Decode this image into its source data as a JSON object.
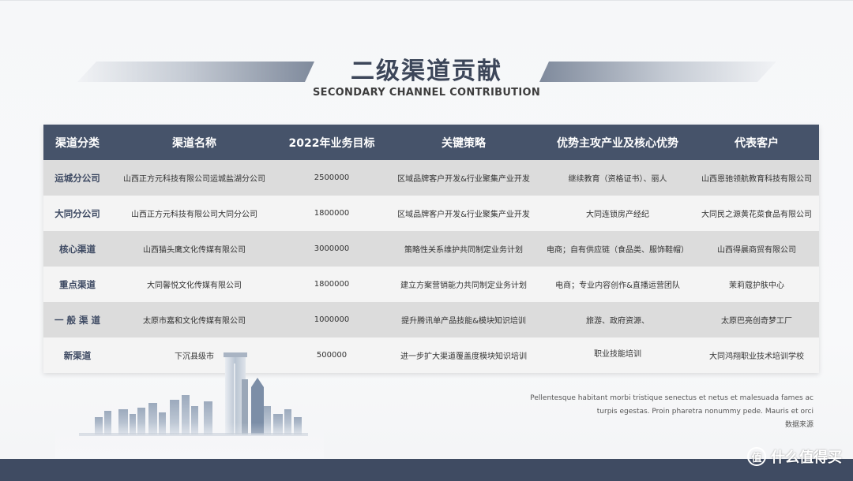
{
  "header": {
    "title": "二级渠道贡献",
    "subtitle": "SECONDARY CHANNEL CONTRIBUTION"
  },
  "table": {
    "columns": [
      "渠道分类",
      "渠道名称",
      "2022年业务目标",
      "关键策略",
      "优势主攻产业及核心优势",
      "代表客户"
    ],
    "rows": [
      {
        "category": "运城分公司",
        "name": "山西正方元科技有限公司运城盐湖分公司",
        "target": "2500000",
        "strategy": "区域品牌客户开发&行业聚集产业开发",
        "advantage": "继续教育（资格证书）、丽人",
        "client": "山西恩驰领航教育科技有限公司"
      },
      {
        "category": "大同分公司",
        "name": "山西正方元科技有限公司大同分公司",
        "target": "1800000",
        "strategy": "区域品牌客户开发&行业聚集产业开发",
        "advantage": "大同连锁房产经纪",
        "client": "大同民之源黄花菜食品有限公司"
      },
      {
        "category": "核心渠道",
        "name": "山西猫头鹰文化传媒有限公司",
        "target": "3000000",
        "strategy": "策略性关系维护共同制定业务计划",
        "advantage": "电商；自有供应链（食品类、服饰鞋帽）",
        "client": "山西得晨商贸有限公司"
      },
      {
        "category": "重点渠道",
        "name": "大同馨悦文化传媒有限公司",
        "target": "1800000",
        "strategy": "建立方案营销能力共同制定业务计划",
        "advantage": "电商；专业内容创作&直播运营团队",
        "client": "茉莉蔻护肤中心"
      },
      {
        "category": "一 般 渠 道",
        "name": "太原市嘉和文化传媒有限公司",
        "target": "1000000",
        "strategy": "提升腾讯单产品技能&模块知识培训",
        "advantage": "旅游、政府资源、",
        "client": "太原巴亮创奇梦工厂"
      },
      {
        "category": "新渠道",
        "name": "下沉县级市",
        "target": "500000",
        "strategy": "进一步扩大渠道覆盖度模块知识培训",
        "advantage": "职业技能培训",
        "client": "大同鸿翔职业技术培训学校"
      }
    ]
  },
  "note": {
    "line1": "Pellentesque habitant morbi tristique senectus et netus et malesuada fames ac",
    "line2": "turpis egestas. Proin pharetra nonummy pede. Mauris et orci",
    "source": "数据来源"
  },
  "watermark": {
    "icon": "值",
    "text": "什么值得买"
  },
  "colors": {
    "header_bg": "#46536a",
    "footer_bg": "#3f4b62",
    "title": "#3c4659",
    "row_dark": "#dcdcdc",
    "row_light": "#f4f4f4"
  }
}
